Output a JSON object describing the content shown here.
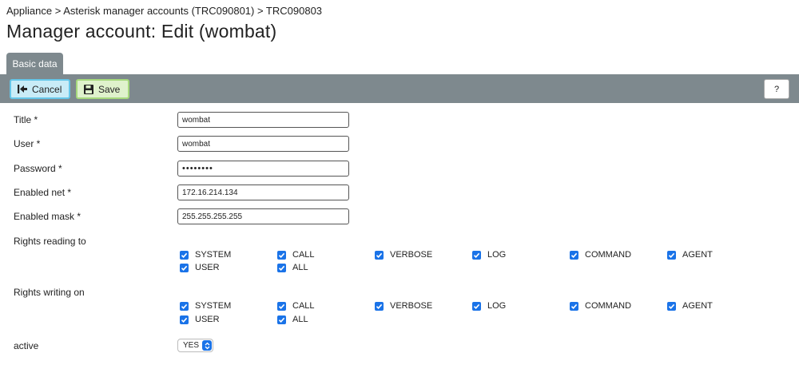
{
  "breadcrumb": "Appliance > Asterisk manager accounts (TRC090801) > TRC090803",
  "page_title": "Manager account: Edit (wombat)",
  "tab_label": "Basic data",
  "toolbar": {
    "cancel_label": "Cancel",
    "save_label": "Save",
    "help_label": "?"
  },
  "fields": {
    "title": {
      "label": "Title *",
      "value": "wombat"
    },
    "user": {
      "label": "User *",
      "value": "wombat"
    },
    "password": {
      "label": "Password *",
      "value": "••••••••"
    },
    "enabled_net": {
      "label": "Enabled net *",
      "value": "172.16.214.134"
    },
    "enabled_mask": {
      "label": "Enabled mask *",
      "value": "255.255.255.255"
    }
  },
  "rights_reading": {
    "label": "Rights reading to",
    "options": [
      {
        "label": "SYSTEM",
        "checked": true
      },
      {
        "label": "CALL",
        "checked": true
      },
      {
        "label": "VERBOSE",
        "checked": true
      },
      {
        "label": "LOG",
        "checked": true
      },
      {
        "label": "COMMAND",
        "checked": true
      },
      {
        "label": "AGENT",
        "checked": true
      },
      {
        "label": "USER",
        "checked": true
      },
      {
        "label": "ALL",
        "checked": true
      }
    ]
  },
  "rights_writing": {
    "label": "Rights writing on",
    "options": [
      {
        "label": "SYSTEM",
        "checked": true
      },
      {
        "label": "CALL",
        "checked": true
      },
      {
        "label": "VERBOSE",
        "checked": true
      },
      {
        "label": "LOG",
        "checked": true
      },
      {
        "label": "COMMAND",
        "checked": true
      },
      {
        "label": "AGENT",
        "checked": true
      },
      {
        "label": "USER",
        "checked": true
      },
      {
        "label": "ALL",
        "checked": true
      }
    ]
  },
  "active": {
    "label": "active",
    "value": "YES"
  },
  "colors": {
    "toolbar_bg": "#7e898e",
    "cancel_bg": "#c9ecf7",
    "save_bg": "#dff2cc",
    "checkbox": "#1a73e8"
  }
}
